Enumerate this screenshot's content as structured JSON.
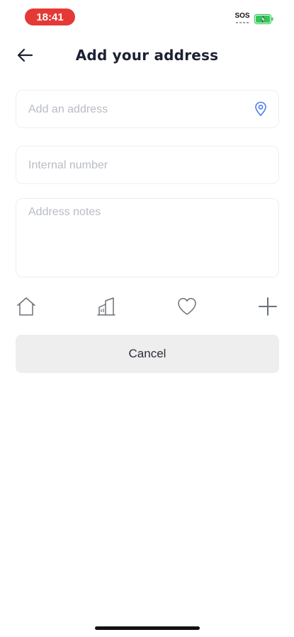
{
  "status_bar": {
    "time": "18:41",
    "sos": "SOS",
    "time_pill_color": "#e53935",
    "battery_color": "#34c759"
  },
  "header": {
    "title": "Add your address",
    "back_icon": "arrow-left-icon"
  },
  "form": {
    "address_placeholder": "Add an address",
    "address_value": "",
    "location_icon": "map-pin-icon",
    "location_icon_color": "#4a7cf0",
    "internal_number_placeholder": "Internal number",
    "internal_number_value": "",
    "notes_placeholder": "Address notes",
    "notes_value": ""
  },
  "address_types": [
    {
      "icon": "home-icon"
    },
    {
      "icon": "building-icon"
    },
    {
      "icon": "heart-icon"
    },
    {
      "icon": "plus-icon"
    }
  ],
  "actions": {
    "cancel_label": "Cancel"
  }
}
